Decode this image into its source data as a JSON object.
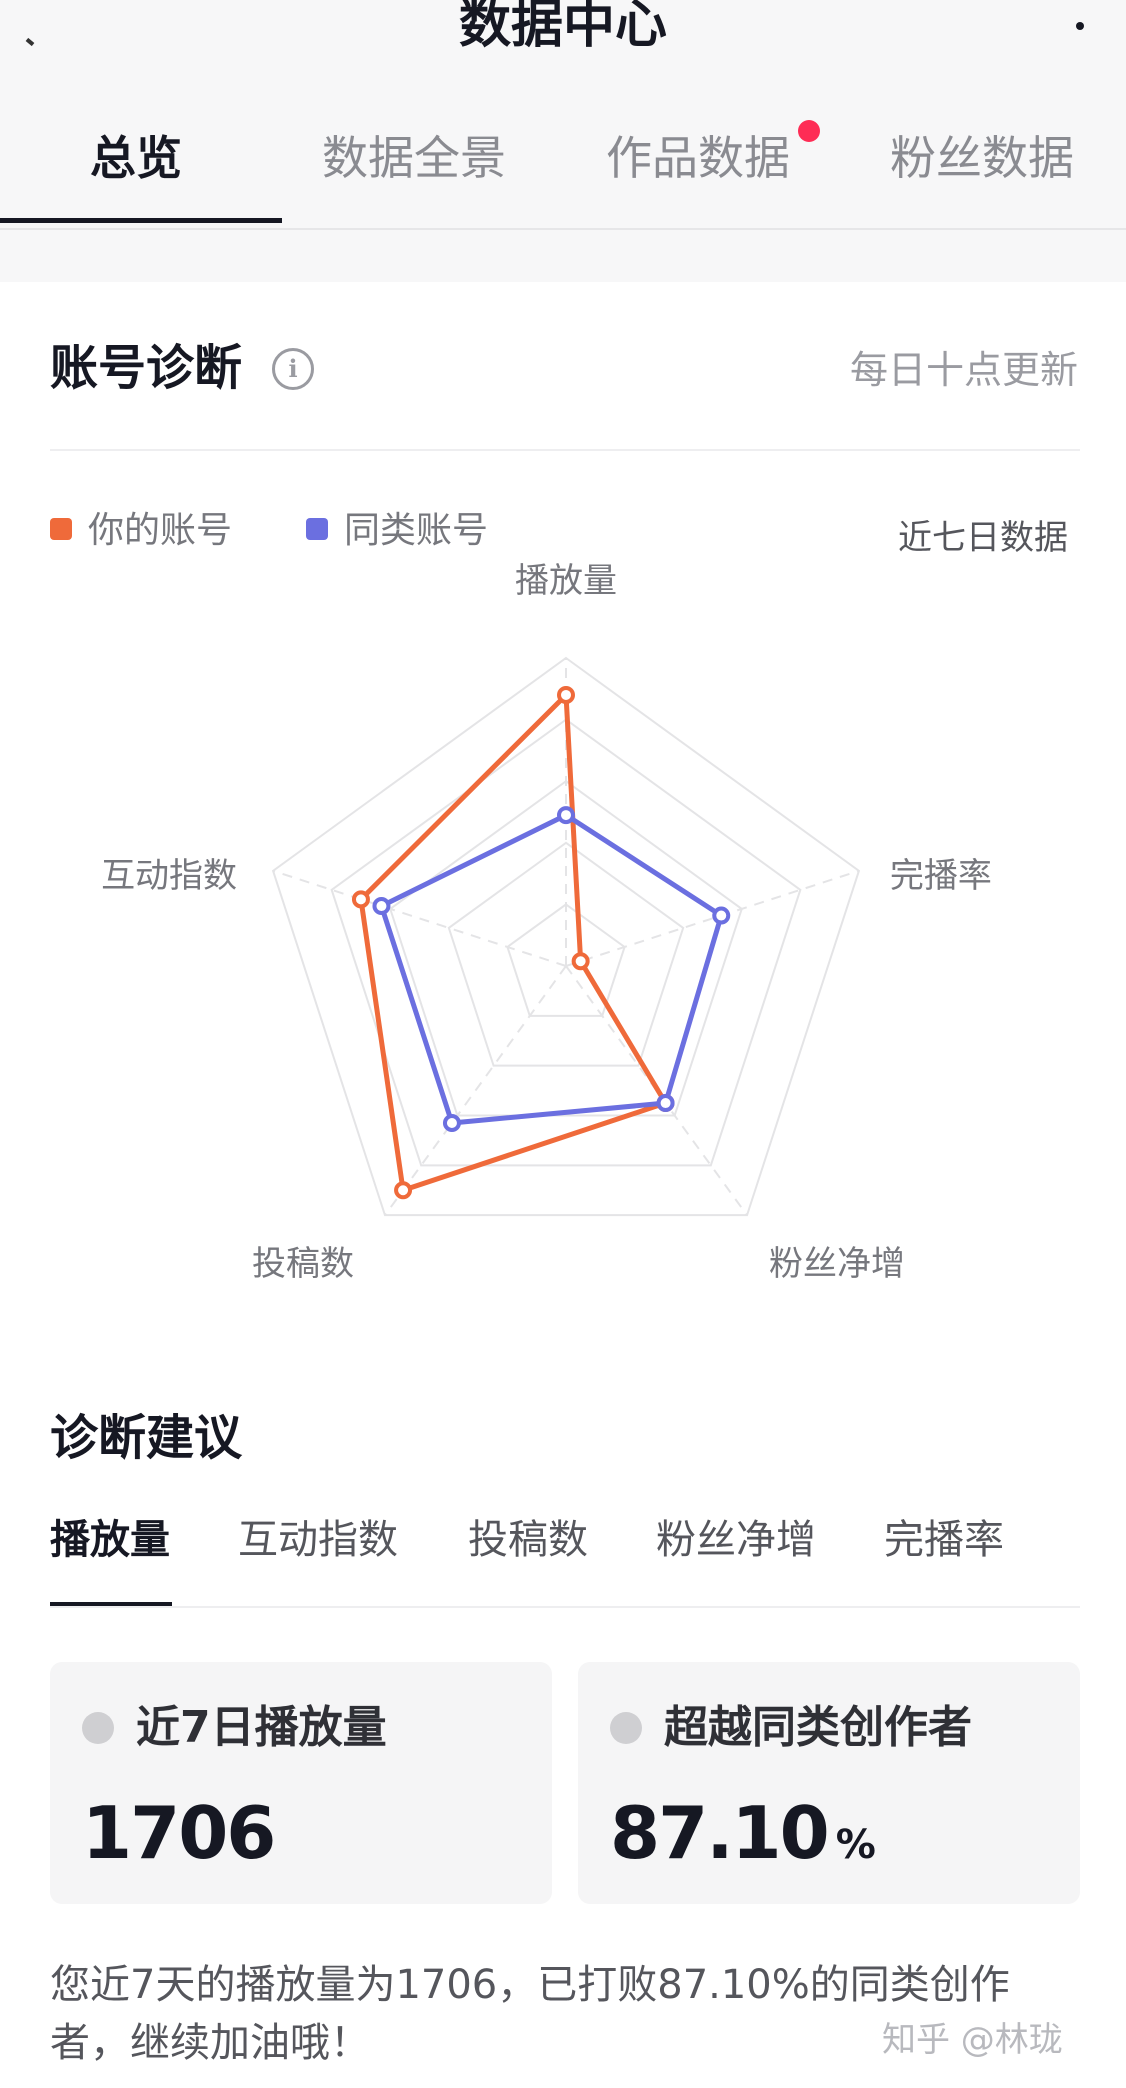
{
  "header": {
    "title": "数据中心"
  },
  "tabs": [
    {
      "label": "总览",
      "active": true
    },
    {
      "label": "数据全景",
      "active": false
    },
    {
      "label": "作品数据",
      "active": false,
      "badge": true
    },
    {
      "label": "粉丝数据",
      "active": false
    }
  ],
  "diagnosis": {
    "title": "账号诊断",
    "info_icon": "info-icon",
    "update_text": "每日十点更新",
    "period_text": "近七日数据"
  },
  "chart_data": {
    "type": "radar",
    "axes": [
      "播放量",
      "完播率",
      "粉丝净增",
      "投稿数",
      "互动指数"
    ],
    "series": [
      {
        "name": "你的账号",
        "color": "#ef6a3a",
        "values": [
          0.88,
          0.05,
          0.55,
          0.9,
          0.7
        ]
      },
      {
        "name": "同类账号",
        "color": "#6b6fe0",
        "values": [
          0.49,
          0.53,
          0.55,
          0.63,
          0.63
        ]
      }
    ],
    "range": [
      0,
      1
    ],
    "rings": 5,
    "legend_position": "top-left"
  },
  "advice": {
    "title": "诊断建议",
    "tabs": [
      {
        "label": "播放量",
        "active": true
      },
      {
        "label": "互动指数",
        "active": false
      },
      {
        "label": "投稿数",
        "active": false
      },
      {
        "label": "粉丝净增",
        "active": false
      },
      {
        "label": "完播率",
        "active": false
      }
    ],
    "stats": [
      {
        "label": "近7日播放量",
        "value": "1706",
        "unit": ""
      },
      {
        "label": "超越同类创作者",
        "value": "87.10",
        "unit": "%"
      }
    ],
    "text": "您近7天的播放量为1706，已打败87.10%的同类创作者，继续加油哦！"
  },
  "watermark": "知乎 @林珑",
  "colors": {
    "accent_dark": "#161823",
    "badge": "#fe2c55"
  }
}
